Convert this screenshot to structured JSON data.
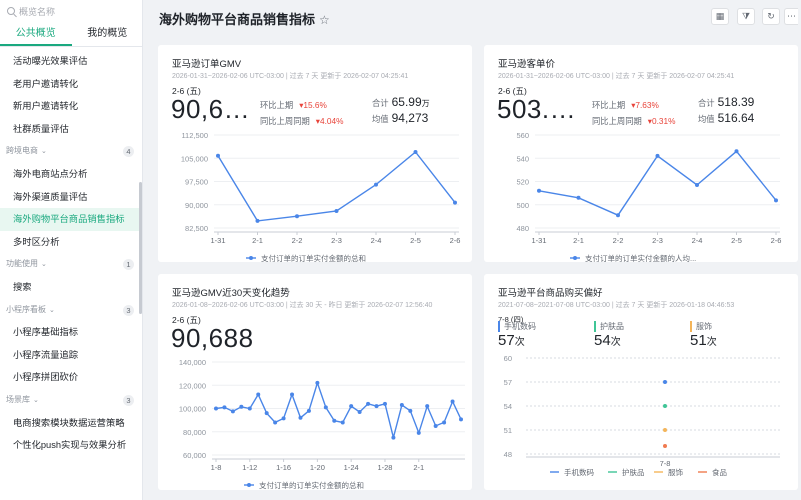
{
  "sidebar": {
    "search_placeholder": "概览名称",
    "tabs": [
      "公共概览",
      "我的概览"
    ],
    "items": [
      {
        "type": "item",
        "label": "活动曝光效果评估"
      },
      {
        "type": "item",
        "label": "老用户邀请转化"
      },
      {
        "type": "item",
        "label": "新用户邀请转化"
      },
      {
        "type": "item",
        "label": "社群质量评估"
      },
      {
        "type": "group",
        "label": "跨境电商",
        "count": "4"
      },
      {
        "type": "item",
        "label": "海外电商站点分析"
      },
      {
        "type": "item",
        "label": "海外渠道质量评估"
      },
      {
        "type": "item",
        "label": "海外购物平台商品销售指标",
        "active": true
      },
      {
        "type": "item",
        "label": "多时区分析"
      },
      {
        "type": "group",
        "label": "功能使用",
        "count": "1"
      },
      {
        "type": "item",
        "label": "搜索"
      },
      {
        "type": "group",
        "label": "小程序看板",
        "count": "3"
      },
      {
        "type": "item",
        "label": "小程序基础指标"
      },
      {
        "type": "item",
        "label": "小程序流量追踪"
      },
      {
        "type": "item",
        "label": "小程序拼团砍价"
      },
      {
        "type": "group",
        "label": "场景库",
        "count": "3"
      },
      {
        "type": "item",
        "label": "电商搜索模块数据运营策略"
      },
      {
        "type": "item",
        "label": "个性化push实现与效果分析"
      }
    ]
  },
  "page": {
    "title": "海外购物平台商品销售指标",
    "star": "☆"
  },
  "toolbar": {
    "icons": [
      "calendar-icon",
      "filter-icon",
      "refresh-icon",
      "more-icon"
    ],
    "glyphs": [
      "▦",
      "⧩",
      "↻",
      "⋯"
    ]
  },
  "cards": [
    {
      "title": "亚马逊订单GMV",
      "subtitle": "2026-01-31~2026-02-06 UTC-03:00 | 过去 7 天 更新于 2026-02-07 04:25:41",
      "date": "2-6 (五)",
      "big": "90,6…",
      "cmp": [
        {
          "label": "环比上期",
          "value": "▾15.6%"
        },
        {
          "label": "同比上周同期",
          "value": "▾4.04%"
        }
      ],
      "totals": [
        {
          "label": "合计",
          "value": "65.99",
          "unit": "万"
        },
        {
          "label": "均值",
          "value": "94,273",
          "unit": ""
        }
      ],
      "legend": "支付订单的订单实付金额的总和"
    },
    {
      "title": "亚马逊客单价",
      "subtitle": "2026-01-31~2026-02-06 UTC-03:00 | 过去 7 天 更新于 2026-02-07 04:25:41",
      "date": "2-6 (五)",
      "big": "503.…",
      "cmp": [
        {
          "label": "环比上期",
          "value": "▾7.63%"
        },
        {
          "label": "同比上周同期",
          "value": "▾0.31%"
        }
      ],
      "totals": [
        {
          "label": "合计",
          "value": "518.39",
          "unit": ""
        },
        {
          "label": "均值",
          "value": "516.64",
          "unit": ""
        }
      ],
      "legend": "支付订单的订单实付金额的人均..."
    },
    {
      "title": "亚马逊GMV近30天变化趋势",
      "subtitle": "2026-01-08~2026-02-06 UTC-03:00 | 过去 30 天 - 昨日 更新于 2026-02-07 12:56:40",
      "date": "2-6 (五)",
      "big": "90,688",
      "legend": "支付订单的订单实付金额的总和"
    },
    {
      "title": "亚马逊平台商品购买偏好",
      "subtitle": "2021-07-08~2021-07-08 UTC-03:00 | 过去 7 天 更新于 2026-01-18 04:46:53",
      "date": "7-8 (四)",
      "cats": [
        {
          "label": "手机数码",
          "value": "57",
          "unit": "次",
          "color": "#4a86e8"
        },
        {
          "label": "护肤品",
          "value": "54",
          "unit": "次",
          "color": "#3fc596"
        },
        {
          "label": "服饰",
          "value": "51",
          "unit": "次",
          "color": "#f4b55a"
        }
      ],
      "legend": [
        {
          "label": "手机数码",
          "color": "#4a86e8"
        },
        {
          "label": "护肤品",
          "color": "#3fc596"
        },
        {
          "label": "服饰",
          "color": "#f4b55a"
        },
        {
          "label": "食品",
          "color": "#f07b50"
        }
      ]
    }
  ],
  "chart_data": [
    {
      "type": "line",
      "title": "亚马逊订单GMV",
      "categories": [
        "1-31",
        "2-1",
        "2-2",
        "2-3",
        "2-4",
        "2-5",
        "2-6"
      ],
      "series": [
        {
          "name": "支付订单的订单实付金额的总和",
          "values": [
            105800,
            84800,
            86300,
            88000,
            96500,
            107000,
            90688
          ]
        }
      ],
      "yticks": [
        82500,
        90000,
        97500,
        105000,
        112500
      ],
      "ylim": [
        82500,
        112500
      ],
      "color": "#4a86e8"
    },
    {
      "type": "line",
      "title": "亚马逊客单价",
      "categories": [
        "1-31",
        "2-1",
        "2-2",
        "2-3",
        "2-4",
        "2-5",
        "2-6"
      ],
      "series": [
        {
          "name": "支付订单的订单实付金额的人均...",
          "values": [
            512,
            506,
            491,
            542,
            517,
            546,
            503.8
          ]
        }
      ],
      "yticks": [
        480,
        500,
        520,
        540,
        560
      ],
      "ylim": [
        480,
        560
      ],
      "color": "#4a86e8"
    },
    {
      "type": "line",
      "title": "亚马逊GMV近30天变化趋势",
      "categories": [
        "1-8",
        "1-9",
        "1-10",
        "1-11",
        "1-12",
        "1-13",
        "1-14",
        "1-15",
        "1-16",
        "1-17",
        "1-18",
        "1-19",
        "1-20",
        "1-21",
        "1-22",
        "1-23",
        "1-24",
        "1-25",
        "1-26",
        "1-27",
        "1-28",
        "1-29",
        "1-30",
        "1-31",
        "2-1",
        "2-2",
        "2-3",
        "2-4",
        "2-5",
        "2-6"
      ],
      "xticklabels": [
        "1-8",
        "1-12",
        "1-16",
        "1-20",
        "1-24",
        "1-28",
        "2-1"
      ],
      "series": [
        {
          "name": "支付订单的订单实付金额的总和",
          "values": [
            100000,
            101000,
            97500,
            101500,
            100000,
            112000,
            96000,
            88000,
            91500,
            112000,
            92000,
            98000,
            122000,
            101000,
            89500,
            88000,
            102000,
            97000,
            104000,
            102000,
            104000,
            75000,
            103000,
            98000,
            79000,
            102000,
            85000,
            88000,
            106000,
            90688
          ]
        }
      ],
      "yticks": [
        60000,
        80000,
        100000,
        120000,
        140000
      ],
      "ylim": [
        60000,
        140000
      ],
      "color": "#4a86e8"
    },
    {
      "type": "scatter",
      "title": "亚马逊平台商品购买偏好",
      "categories": [
        "7-8"
      ],
      "series": [
        {
          "name": "手机数码",
          "values": [
            57
          ]
        },
        {
          "name": "护肤品",
          "values": [
            54
          ]
        },
        {
          "name": "服饰",
          "values": [
            51
          ]
        },
        {
          "name": "食品",
          "values": [
            49
          ]
        }
      ],
      "yticks": [
        48,
        51,
        54,
        57,
        60
      ],
      "ylim": [
        47,
        60
      ]
    }
  ]
}
